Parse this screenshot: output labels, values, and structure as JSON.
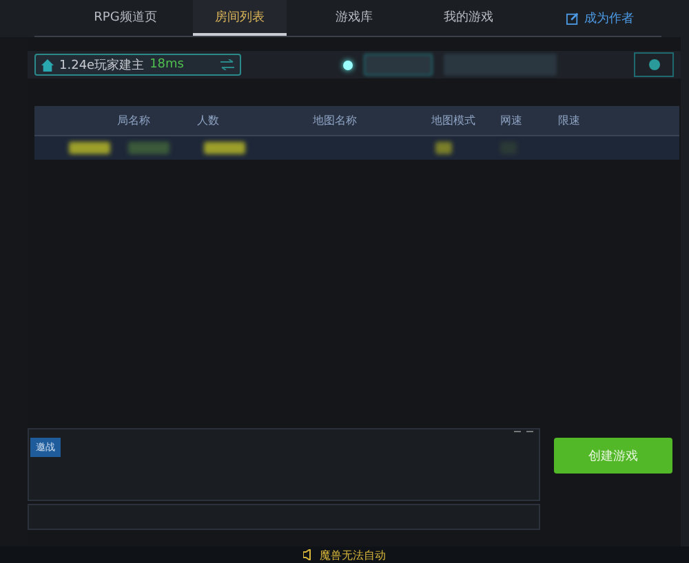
{
  "nav": {
    "tabs": [
      {
        "label": "RPG频道页",
        "selected": false
      },
      {
        "label": "房间列表",
        "selected": true
      },
      {
        "label": "游戏库",
        "selected": false
      },
      {
        "label": "我的游戏",
        "selected": false
      }
    ],
    "author_link": "成为作者"
  },
  "toolbar": {
    "server": "1.24e玩家建主",
    "ping": "18ms"
  },
  "table": {
    "columns": [
      "局名称",
      "人数",
      "地图名称",
      "地图模式",
      "网速",
      "限速"
    ],
    "rows": [
      {
        "selected": true
      }
    ]
  },
  "chat": {
    "tab": "邀战"
  },
  "create_button": "创建游戏",
  "status_bar": {
    "message": "魔兽无法自动"
  }
}
